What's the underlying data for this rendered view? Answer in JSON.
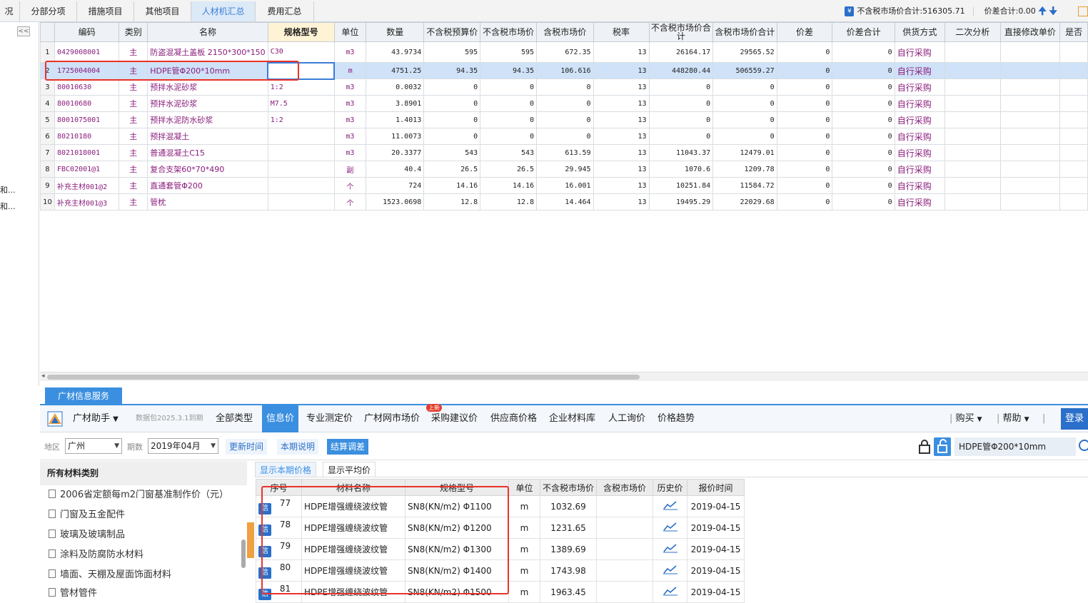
{
  "top_tabs": [
    "况",
    "分部分项",
    "措施项目",
    "其他项目",
    "人材机汇总",
    "费用汇总"
  ],
  "summary": {
    "market_total_label": "不含税市场价合计:516305.71",
    "diff_total_label": "价差合计:0.00"
  },
  "left_labels": [
    "和...",
    "和..."
  ],
  "collapse_glyph": "<<",
  "grid": {
    "headers": [
      "编码",
      "类别",
      "名称",
      "规格型号",
      "单位",
      "数量",
      "不含税预算价",
      "不含税市场价",
      "含税市场价",
      "税率",
      "不含税市场价合计",
      "含税市场价合计",
      "价差",
      "价差合计",
      "供货方式",
      "二次分析",
      "直接修改单价",
      "是否"
    ],
    "rows": [
      {
        "no": "1",
        "code": "0429008001",
        "cat": "主",
        "name": "防盗混凝土盖板 2150*300*150",
        "spec": "C30",
        "unit": "m3",
        "qty": "43.9734",
        "budget": "595",
        "market": "595",
        "market_tax": "672.35",
        "tax": "13",
        "market_total": "26164.17",
        "market_tax_total": "29565.52",
        "diff": "0",
        "diff_total": "0",
        "supply": "自行采购"
      },
      {
        "no": "2",
        "code": "1725004004",
        "cat": "主",
        "name": "HDPE管Φ200*10mm",
        "spec": "",
        "unit": "m",
        "qty": "4751.25",
        "budget": "94.35",
        "market": "94.35",
        "market_tax": "106.616",
        "tax": "13",
        "market_total": "448280.44",
        "market_tax_total": "506559.27",
        "diff": "0",
        "diff_total": "0",
        "supply": "自行采购"
      },
      {
        "no": "3",
        "code": "80010630",
        "cat": "主",
        "name": "预拌水泥砂浆",
        "spec": "1:2",
        "unit": "m3",
        "qty": "0.0032",
        "budget": "0",
        "market": "0",
        "market_tax": "0",
        "tax": "13",
        "market_total": "0",
        "market_tax_total": "0",
        "diff": "0",
        "diff_total": "0",
        "supply": "自行采购"
      },
      {
        "no": "4",
        "code": "80010680",
        "cat": "主",
        "name": "预拌水泥砂浆",
        "spec": "M7.5",
        "unit": "m3",
        "qty": "3.8901",
        "budget": "0",
        "market": "0",
        "market_tax": "0",
        "tax": "13",
        "market_total": "0",
        "market_tax_total": "0",
        "diff": "0",
        "diff_total": "0",
        "supply": "自行采购"
      },
      {
        "no": "5",
        "code": "8001075001",
        "cat": "主",
        "name": "预拌水泥防水砂浆",
        "spec": "1:2",
        "unit": "m3",
        "qty": "1.4013",
        "budget": "0",
        "market": "0",
        "market_tax": "0",
        "tax": "13",
        "market_total": "0",
        "market_tax_total": "0",
        "diff": "0",
        "diff_total": "0",
        "supply": "自行采购"
      },
      {
        "no": "6",
        "code": "80210180",
        "cat": "主",
        "name": "预拌混凝土",
        "spec": "",
        "unit": "m3",
        "qty": "11.0073",
        "budget": "0",
        "market": "0",
        "market_tax": "0",
        "tax": "13",
        "market_total": "0",
        "market_tax_total": "0",
        "diff": "0",
        "diff_total": "0",
        "supply": "自行采购"
      },
      {
        "no": "7",
        "code": "8021018001",
        "cat": "主",
        "name": "普通混凝土C15",
        "spec": "",
        "unit": "m3",
        "qty": "20.3377",
        "budget": "543",
        "market": "543",
        "market_tax": "613.59",
        "tax": "13",
        "market_total": "11043.37",
        "market_tax_total": "12479.01",
        "diff": "0",
        "diff_total": "0",
        "supply": "自行采购"
      },
      {
        "no": "8",
        "code": "FBC02001@1",
        "cat": "主",
        "name": "复合支架60*70*490",
        "spec": "",
        "unit": "副",
        "qty": "40.4",
        "budget": "26.5",
        "market": "26.5",
        "market_tax": "29.945",
        "tax": "13",
        "market_total": "1070.6",
        "market_tax_total": "1209.78",
        "diff": "0",
        "diff_total": "0",
        "supply": "自行采购"
      },
      {
        "no": "9",
        "code": "补充主材001@2",
        "cat": "主",
        "name": "直通套管Φ200",
        "spec": "",
        "unit": "个",
        "qty": "724",
        "budget": "14.16",
        "market": "14.16",
        "market_tax": "16.001",
        "tax": "13",
        "market_total": "10251.84",
        "market_tax_total": "11584.72",
        "diff": "0",
        "diff_total": "0",
        "supply": "自行采购"
      },
      {
        "no": "10",
        "code": "补充主材001@3",
        "cat": "主",
        "name": "管枕",
        "spec": "",
        "unit": "个",
        "qty": "1523.0698",
        "budget": "12.8",
        "market": "12.8",
        "market_tax": "14.464",
        "tax": "13",
        "market_total": "19495.29",
        "market_tax_total": "22029.68",
        "diff": "0",
        "diff_total": "0",
        "supply": "自行采购"
      }
    ]
  },
  "gcx": {
    "service_tab": "广材信息服务",
    "assistant": "广材助手",
    "data_package": "数据包2025.3.1到期",
    "tabs": [
      "全部类型",
      "信息价",
      "专业测定价",
      "广材网市场价",
      "采购建议价",
      "供应商价格",
      "企业材料库",
      "人工询价",
      "价格趋势"
    ],
    "new_badge": "上新",
    "buy": "购买",
    "help": "帮助",
    "login": "登录"
  },
  "filters": {
    "region_label": "地区",
    "region_value": "广州",
    "period_label": "期数",
    "period_value": "2019年04月",
    "btn_update": "更新时间",
    "btn_desc": "本期说明",
    "btn_settle": "结算调差",
    "search_value": "HDPE管Φ200*10mm"
  },
  "side": {
    "title": "所有材料类别",
    "items": [
      "2006省定额每m2门窗基准制作价（元）",
      "门窗及五金配件",
      "玻璃及玻璃制品",
      "涂料及防腐防水材料",
      "墙面、天棚及屋面饰面材料",
      "管材管件"
    ]
  },
  "subtabs": [
    "显示本期价格",
    "显示平均价"
  ],
  "prices": {
    "headers": [
      "序号",
      "材料名称",
      "规格型号",
      "单位",
      "不含税市场价",
      "含税市场价",
      "历史价",
      "报价时间"
    ],
    "icon_label": "信",
    "rows": [
      {
        "no": "77",
        "name": "HDPE增强缠绕波纹管",
        "spec": "SN8(KN/m2) Φ1100",
        "unit": "m",
        "price": "1032.69",
        "price_tax": "",
        "date": "2019-04-15"
      },
      {
        "no": "78",
        "name": "HDPE增强缠绕波纹管",
        "spec": "SN8(KN/m2) Φ1200",
        "unit": "m",
        "price": "1231.65",
        "price_tax": "",
        "date": "2019-04-15"
      },
      {
        "no": "79",
        "name": "HDPE增强缠绕波纹管",
        "spec": "SN8(KN/m2) Φ1300",
        "unit": "m",
        "price": "1389.69",
        "price_tax": "",
        "date": "2019-04-15"
      },
      {
        "no": "80",
        "name": "HDPE增强缠绕波纹管",
        "spec": "SN8(KN/m2) Φ1400",
        "unit": "m",
        "price": "1743.98",
        "price_tax": "",
        "date": "2019-04-15"
      },
      {
        "no": "81",
        "name": "HDPE增强缠绕波纹管",
        "spec": "SN8(KN/m2) Φ1500",
        "unit": "m",
        "price": "1963.45",
        "price_tax": "",
        "date": "2019-04-15"
      }
    ]
  }
}
